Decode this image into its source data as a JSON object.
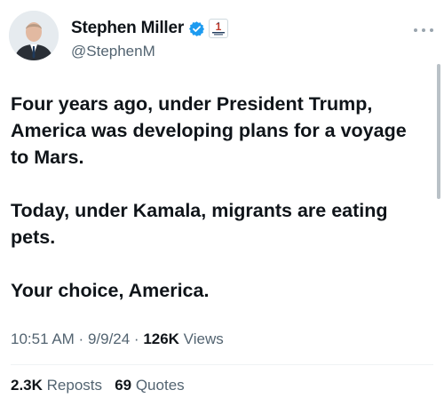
{
  "author": {
    "display_name": "Stephen Miller",
    "handle": "@StephenM",
    "avatar_icon": "profile-photo",
    "verified_icon": "verified-badge-icon",
    "affiliation_icon": "affiliation-badge-icon",
    "affiliation_number": "1"
  },
  "tweet": {
    "paragraphs": [
      "Four years ago, under President Trump, America was developing plans for a voyage to Mars.",
      "Today, under Kamala, migrants are eating pets.",
      "Your choice, America."
    ]
  },
  "meta": {
    "time": "10:51 AM",
    "sep1": " · ",
    "date": "9/9/24",
    "sep2": " · ",
    "views_count": "126K",
    "views_label": " Views"
  },
  "stats": {
    "reposts_count": "2.3K",
    "reposts_label": " Reposts",
    "quotes_count": "69",
    "quotes_label": " Quotes"
  },
  "colors": {
    "primary_text": "#0f1419",
    "secondary_text": "#536471",
    "verified_blue": "#1d9bf0"
  }
}
